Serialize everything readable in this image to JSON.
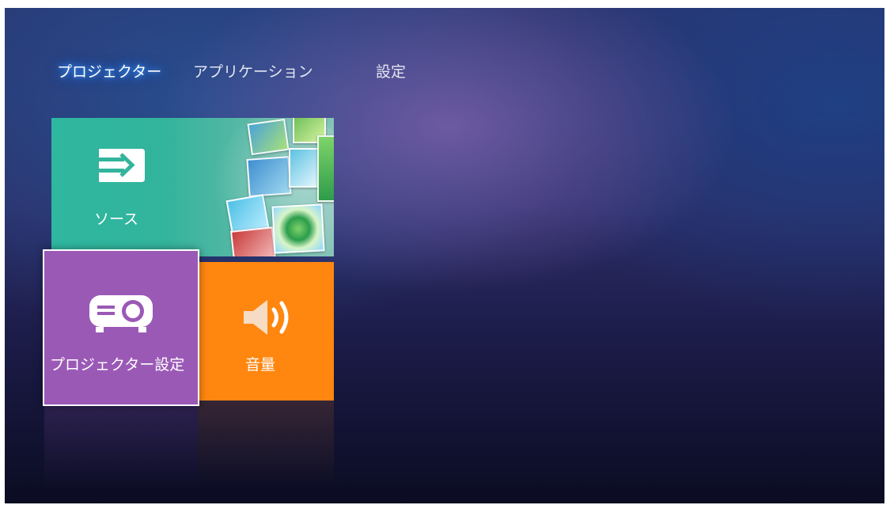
{
  "tabs": [
    {
      "label": "プロジェクター",
      "active": true
    },
    {
      "label": "アプリケーション",
      "active": false
    },
    {
      "label": "設定",
      "active": false
    }
  ],
  "tiles": {
    "source": {
      "label": "ソース",
      "icon": "input-arrow-icon",
      "color": "#33b49c"
    },
    "projector_settings": {
      "label": "プロジェクター設定",
      "icon": "projector-icon",
      "color": "#9b59b6"
    },
    "volume": {
      "label": "音量",
      "icon": "speaker-icon",
      "color": "#ff8710"
    }
  },
  "colors": {
    "active_tab_glow": "#3fa0ff",
    "background_top": "#2a3470",
    "background_bottom": "#0b0c22"
  }
}
